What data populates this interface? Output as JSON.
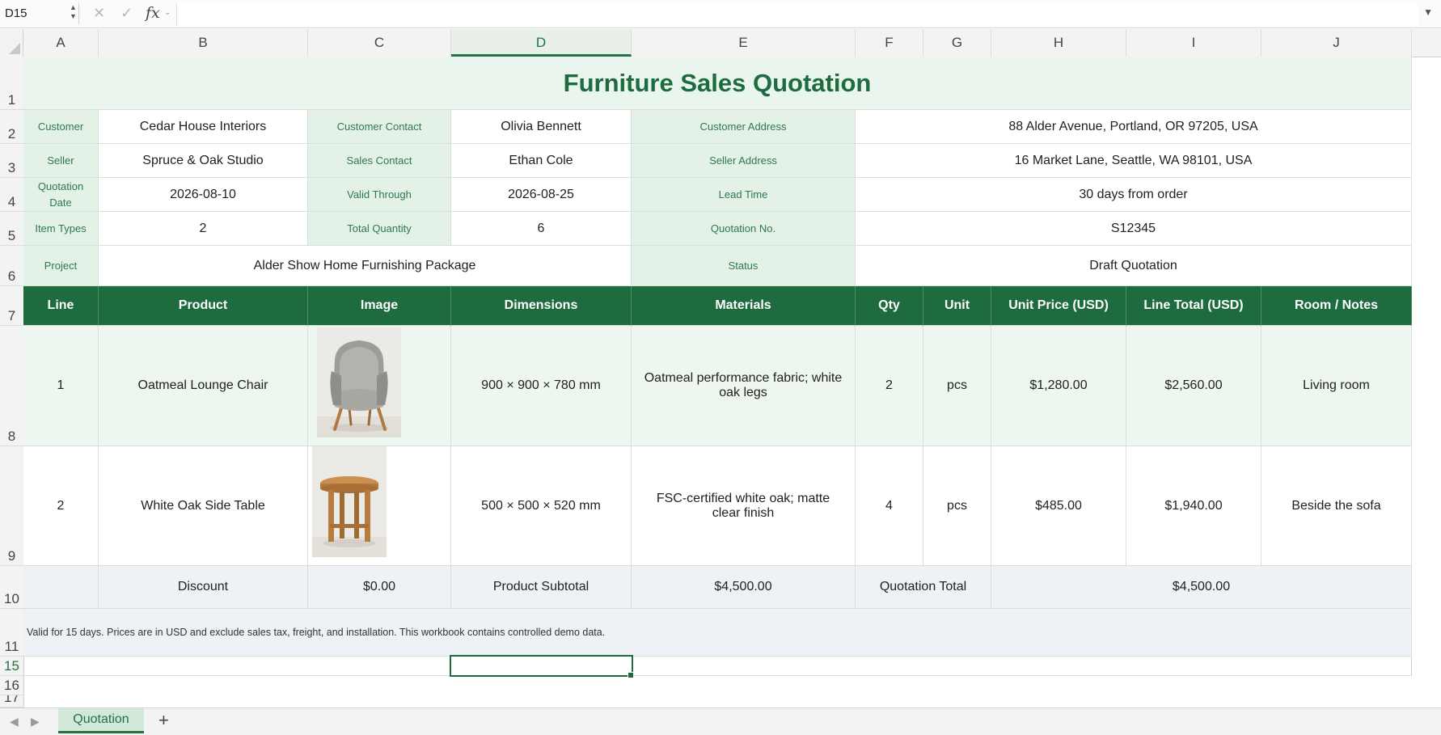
{
  "formula_bar": {
    "cell_ref": "D15",
    "cancel_icon": "close-icon",
    "confirm_icon": "check-icon",
    "fx_label": "fx",
    "value": ""
  },
  "columns": [
    "A",
    "B",
    "C",
    "D",
    "E",
    "F",
    "G",
    "H",
    "I",
    "J"
  ],
  "selected_column": "D",
  "rows": [
    "1",
    "2",
    "3",
    "4",
    "5",
    "6",
    "7",
    "8",
    "9",
    "10",
    "11",
    "15",
    "16",
    "17"
  ],
  "selected_row": "15",
  "sheet": {
    "title": "Furniture Sales Quotation",
    "info": {
      "customer_label": "Customer",
      "customer": "Cedar House Interiors",
      "customer_contact_label": "Customer Contact",
      "customer_contact": "Olivia Bennett",
      "customer_address_label": "Customer Address",
      "customer_address": "88 Alder Avenue, Portland, OR 97205, USA",
      "seller_label": "Seller",
      "seller": "Spruce & Oak Studio",
      "sales_contact_label": "Sales Contact",
      "sales_contact": "Ethan Cole",
      "seller_address_label": "Seller Address",
      "seller_address": "16 Market Lane, Seattle, WA 98101, USA",
      "quotation_date_label": "Quotation Date",
      "quotation_date": "2026-08-10",
      "valid_through_label": "Valid Through",
      "valid_through": "2026-08-25",
      "lead_time_label": "Lead Time",
      "lead_time": "30 days from order",
      "item_types_label": "Item Types",
      "item_types": "2",
      "total_quantity_label": "Total Quantity",
      "total_quantity": "6",
      "quotation_no_label": "Quotation No.",
      "quotation_no": "S12345",
      "project_label": "Project",
      "project": "Alder Show Home Furnishing Package",
      "status_label": "Status",
      "status": "Draft Quotation"
    },
    "table_headers": [
      "Line",
      "Product",
      "Image",
      "Dimensions",
      "Materials",
      "Qty",
      "Unit",
      "Unit Price (USD)",
      "Line Total (USD)",
      "Room / Notes"
    ],
    "items": [
      {
        "line": "1",
        "product": "Oatmeal Lounge Chair",
        "image": "lounge-chair-image",
        "dimensions": "900 × 900 × 780 mm",
        "materials": "Oatmeal performance fabric; white oak legs",
        "qty": "2",
        "unit": "pcs",
        "unit_price": "$1,280.00",
        "line_total": "$2,560.00",
        "notes": "Living room"
      },
      {
        "line": "2",
        "product": "White Oak Side Table",
        "image": "side-table-image",
        "dimensions": "500 × 500 × 520 mm",
        "materials": "FSC-certified white oak; matte clear finish",
        "qty": "4",
        "unit": "pcs",
        "unit_price": "$485.00",
        "line_total": "$1,940.00",
        "notes": "Beside the sofa"
      }
    ],
    "totals": {
      "discount_label": "Discount",
      "discount": "$0.00",
      "subtotal_label": "Product Subtotal",
      "subtotal": "$4,500.00",
      "total_label": "Quotation Total",
      "total": "$4,500.00"
    },
    "note": "Valid for 15 days. Prices are in USD and exclude sales tax, freight, and installation. This workbook contains controlled demo data."
  },
  "tabs": {
    "sheet_name": "Quotation",
    "add_label": "+"
  },
  "colors": {
    "accent": "#1d6b3f",
    "label_bg": "#e3f1e7",
    "title_bg": "#eaf5ed"
  }
}
